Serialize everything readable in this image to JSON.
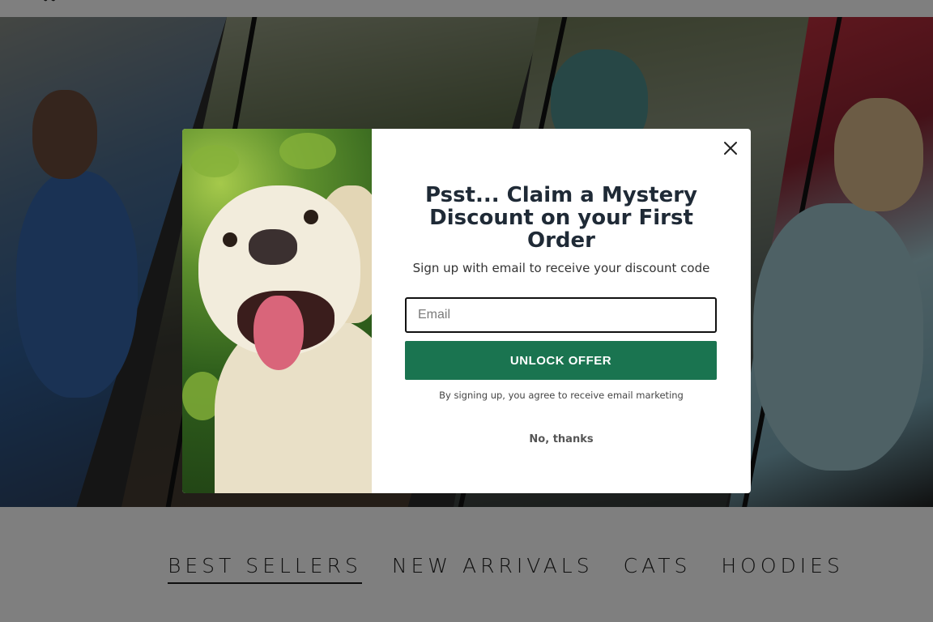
{
  "header": {
    "logo_icon": "paw-logo-icon"
  },
  "nav_tabs": [
    {
      "label": "BEST SELLERS",
      "active": true
    },
    {
      "label": "NEW ARRIVALS",
      "active": false
    },
    {
      "label": "CATS",
      "active": false
    },
    {
      "label": "HOODIES",
      "active": false
    }
  ],
  "popup": {
    "title": "Psst... Claim a Mystery Discount on your First Order",
    "subtitle": "Sign up with email to receive your discount code",
    "email": {
      "placeholder": "Email",
      "value": ""
    },
    "cta_label": "UNLOCK OFFER",
    "disclaimer": "By signing up, you agree to receive email marketing",
    "decline_label": "No, thanks",
    "close_icon": "close-icon"
  },
  "colors": {
    "cta_green": "#1a7450",
    "title_text": "#1f2a36",
    "overlay": "rgba(0,0,0,0.5)"
  }
}
